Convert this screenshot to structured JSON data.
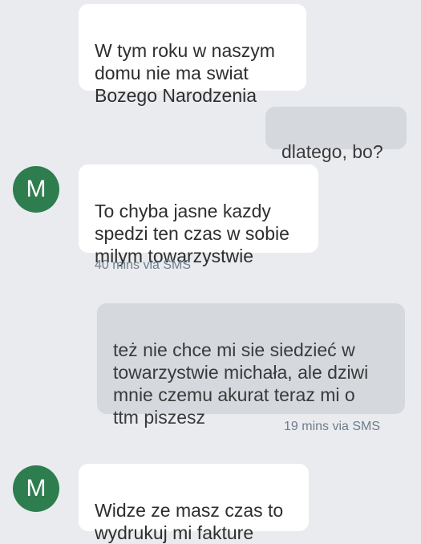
{
  "conversation": {
    "messages": [
      {
        "direction": "incoming",
        "text": "W tym roku w naszym\ndomu nie ma swiat\nBozego Narodzenia"
      },
      {
        "direction": "outgoing",
        "text": "dlatego, bo?"
      },
      {
        "direction": "incoming",
        "avatar_letter": "M",
        "text": "To chyba jasne kazdy\nspedzi ten czas w sobie\nmilym towarzystwie",
        "meta": "40 mins via SMS"
      },
      {
        "direction": "outgoing",
        "text": "też nie chce mi sie siedzieć w\ntowarzystwie michała, ale dziwi\nmnie czemu akurat teraz mi o\nttm piszesz",
        "meta": "19 mins via SMS"
      },
      {
        "direction": "incoming",
        "avatar_letter": "M",
        "text": "Widze ze masz czas to\nwydrukuj mi fakture"
      }
    ]
  },
  "colors": {
    "background": "#e9ebee",
    "incoming_bubble": "#ffffff",
    "outgoing_bubble": "#d5d9de",
    "avatar": "#2e7d4f",
    "meta_text": "#6f7d8c"
  }
}
